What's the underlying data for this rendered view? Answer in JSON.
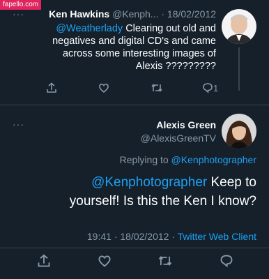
{
  "watermark": "fapello.com",
  "reply": {
    "author_name": "Ken Hawkins",
    "author_handle": "@Kenph...",
    "date": "18/02/2012",
    "mention": "@Weatherlady",
    "text_line1": "Clearing out old and",
    "text_line2": "negatives and digital CD's and came",
    "text_line3": "across some interesting images of",
    "text_line4": "Alexis ?????????",
    "reply_count": "1"
  },
  "main": {
    "author_name": "Alexis Green",
    "author_handle": "@AlexisGreenTV",
    "replying_to_label": "Replying to",
    "replying_to_handle": "@Kenphotographer",
    "mention": "@Kenphotographer",
    "text_line1_rest": "Keep to",
    "text_line2": "yourself! Is this the Ken I know?",
    "time": "19:41",
    "date": "18/02/2012",
    "client": "Twitter Web Client"
  },
  "separator_dot": "·",
  "more_dots": "···",
  "colors": {
    "background": "#15202b",
    "accent": "#1da1f2",
    "muted": "#8899a6"
  }
}
